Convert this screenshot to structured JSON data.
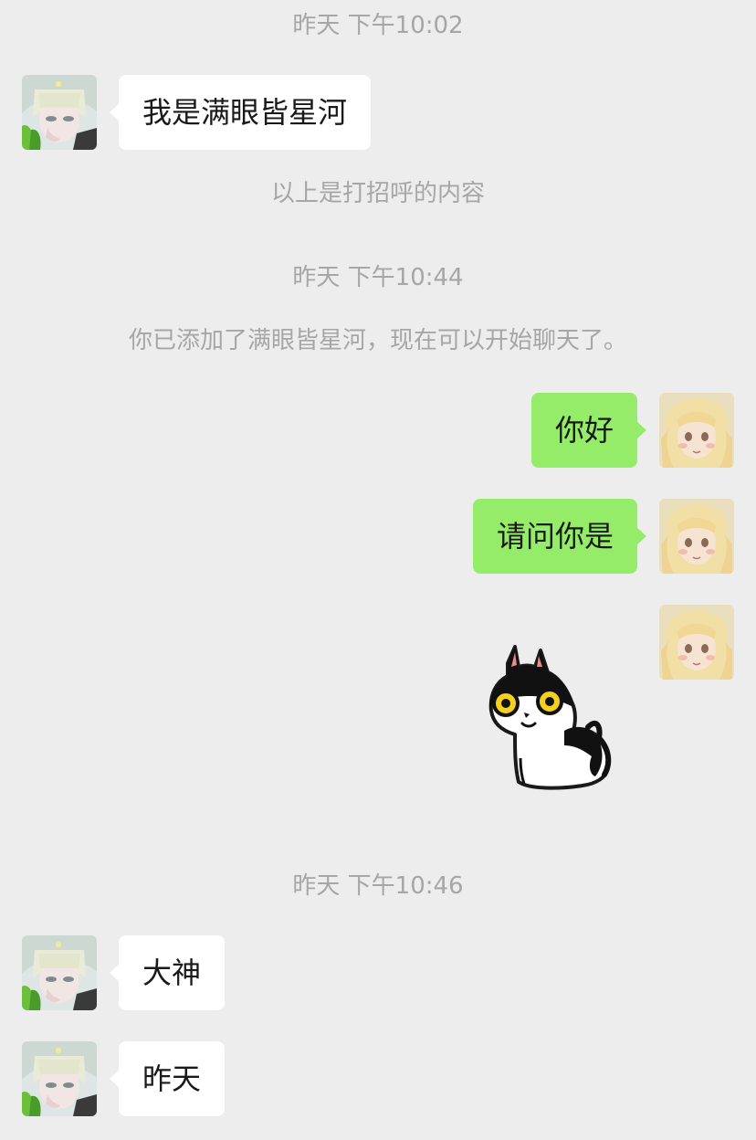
{
  "chat": {
    "ts1": "昨天 下午10:02",
    "msg1": "我是满眼皆星河",
    "notice1": "以上是打招呼的内容",
    "ts2": "昨天 下午10:44",
    "notice2": "你已添加了满眼皆星河，现在可以开始聊天了。",
    "msg2": "你好",
    "msg3": "请问你是",
    "sticker": "cat-sticker",
    "ts3": "昨天 下午10:46",
    "msg4": "大神",
    "msg5": "昨天"
  },
  "colors": {
    "background": "#ededed",
    "incoming_bubble": "#ffffff",
    "outgoing_bubble": "#95ec69",
    "meta_text": "#a6a6a6"
  }
}
